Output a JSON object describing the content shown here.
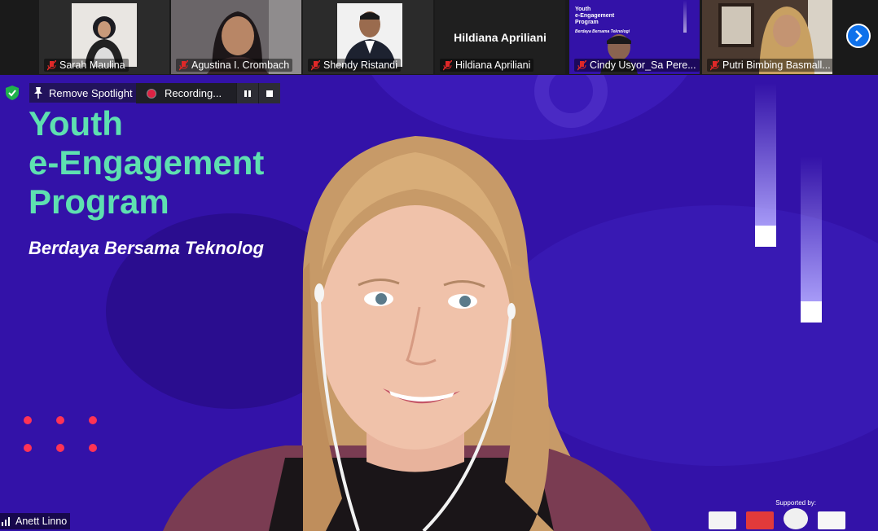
{
  "participants": [
    {
      "name": "Sarah Maulina",
      "muted": true
    },
    {
      "name": "Agustina I. Crombach",
      "muted": true
    },
    {
      "name": "Shendy Ristandi",
      "muted": true
    },
    {
      "name": "Hildiana Apriliani",
      "muted": true,
      "video_off": true
    },
    {
      "name": "Cindy Usyor_Sa Pere...",
      "muted": true
    },
    {
      "name": "Putri Bimbing Basmall...",
      "muted": true
    }
  ],
  "toolbar": {
    "remove_spotlight_label": "Remove Spotlight",
    "recording_label": "Recording..."
  },
  "slide": {
    "title_lines": [
      "Youth",
      "e-Engagement",
      "Program"
    ],
    "subtitle": "Berdaya Bersama Teknolog",
    "supported_by": "Supported by:",
    "thumb_title": [
      "Youth",
      "e-Engagement",
      "Program"
    ],
    "thumb_subtitle": "Berdaya Bersama Teknologi"
  },
  "active_speaker": {
    "name": "Anett Linno"
  },
  "colors": {
    "slide_bg": "#3312a8",
    "title": "#5ee0b0",
    "accent_blue": "#0e71eb",
    "muted_red": "#e02828"
  }
}
